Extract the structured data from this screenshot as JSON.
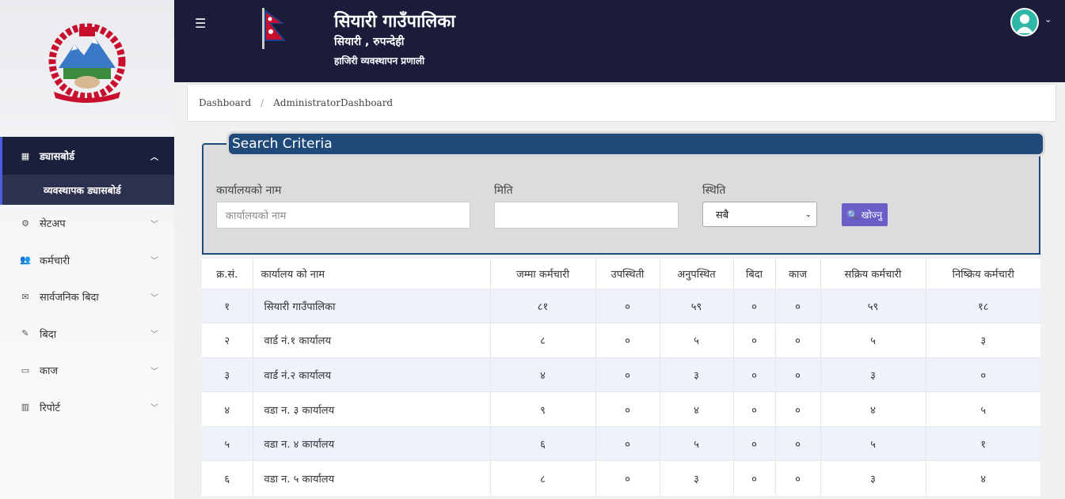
{
  "header": {
    "title": "सियारी गाउँपालिका",
    "subtitle": "सियारी , रुपन्देही",
    "system": "हाजिरी व्यवस्थापन प्रणाली"
  },
  "sidebar": {
    "items": [
      {
        "label": "ड्यासबोर्ड",
        "icon": "dashboard-icon",
        "expanded": true
      },
      {
        "label": "सेटअप",
        "icon": "cogs-icon"
      },
      {
        "label": "कर्मचारी",
        "icon": "users-icon"
      },
      {
        "label": "सार्वजनिक बिदा",
        "icon": "envelope-icon"
      },
      {
        "label": "बिदा",
        "icon": "edit-icon"
      },
      {
        "label": "काज",
        "icon": "desktop-icon"
      },
      {
        "label": "रिपोर्ट",
        "icon": "bar-chart-icon"
      }
    ],
    "sub_item": "व्यवस्थापक ड्यासबोर्ड"
  },
  "breadcrumb": {
    "items": [
      "Dashboard",
      "AdministratorDashboard"
    ],
    "separator": "/"
  },
  "search": {
    "legend": "Search Criteria",
    "office_label": "कार्यालयको नाम",
    "office_placeholder": "कार्यालयको नाम",
    "date_label": "मिति",
    "date_value": "",
    "status_label": "स्थिति",
    "status_value": "सबै",
    "search_button": "खोज्नु"
  },
  "table": {
    "headers": [
      "क्र.सं.",
      "कार्यालय को नाम",
      "जम्मा कर्मचारी",
      "उपस्थिती",
      "अनुपस्थित",
      "बिदा",
      "काज",
      "सक्रिय कर्मचारी",
      "निष्क्रिय कर्मचारी"
    ],
    "rows": [
      [
        "१",
        "सियारी गाउँपालिका",
        "८१",
        "०",
        "५९",
        "०",
        "०",
        "५९",
        "१८"
      ],
      [
        "२",
        "वार्ड नं.१ कार्यालय",
        "८",
        "०",
        "५",
        "०",
        "०",
        "५",
        "३"
      ],
      [
        "३",
        "वार्ड नं.२ कार्यालय",
        "४",
        "०",
        "३",
        "०",
        "०",
        "३",
        "०"
      ],
      [
        "४",
        "वडा न. ३ कार्यालय",
        "९",
        "०",
        "४",
        "०",
        "०",
        "४",
        "५"
      ],
      [
        "५",
        "वडा न. ४ कार्यालय",
        "६",
        "०",
        "५",
        "०",
        "०",
        "५",
        "१"
      ],
      [
        "६",
        "वडा न. ५ कार्यालय",
        "८",
        "०",
        "३",
        "०",
        "०",
        "३",
        "४"
      ]
    ]
  },
  "colors": {
    "header_bg": "#1a1c3a",
    "active_menu_bg": "#1a1f3c",
    "legend_bg": "#1f4a7a",
    "button_bg": "#6a5fc8",
    "stripe_bg": "#eef2fb"
  }
}
